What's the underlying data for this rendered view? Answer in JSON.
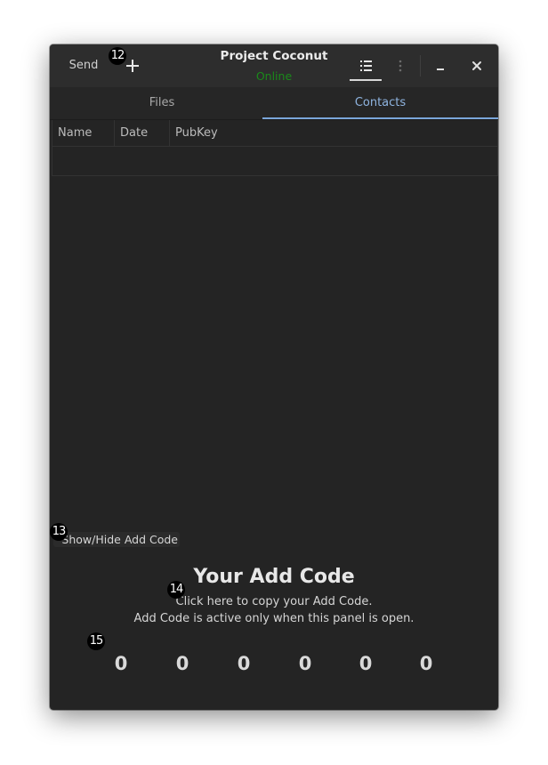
{
  "header": {
    "send_label": "Send",
    "title": "Project Coconut",
    "status": "Online",
    "status_color": "#1a8a1a",
    "icons": [
      "plus-icon",
      "list-icon",
      "kebab-menu-icon",
      "minimize-icon",
      "close-icon"
    ]
  },
  "tabs": [
    {
      "label": "Files",
      "active": false
    },
    {
      "label": "Contacts",
      "active": true
    }
  ],
  "table": {
    "columns": [
      "Name",
      "Date",
      "PubKey"
    ],
    "rows": []
  },
  "add_code": {
    "toggle_label": "Show/Hide Add Code",
    "title": "Your Add Code",
    "copy_hint": "Click here to copy your Add Code.",
    "active_note": "Add Code is active only when this panel is open.",
    "digits": [
      "0",
      "0",
      "0",
      "0",
      "0",
      "0"
    ]
  },
  "markers": [
    "12",
    "13",
    "14",
    "15"
  ],
  "accent_color": "#7aa6da"
}
